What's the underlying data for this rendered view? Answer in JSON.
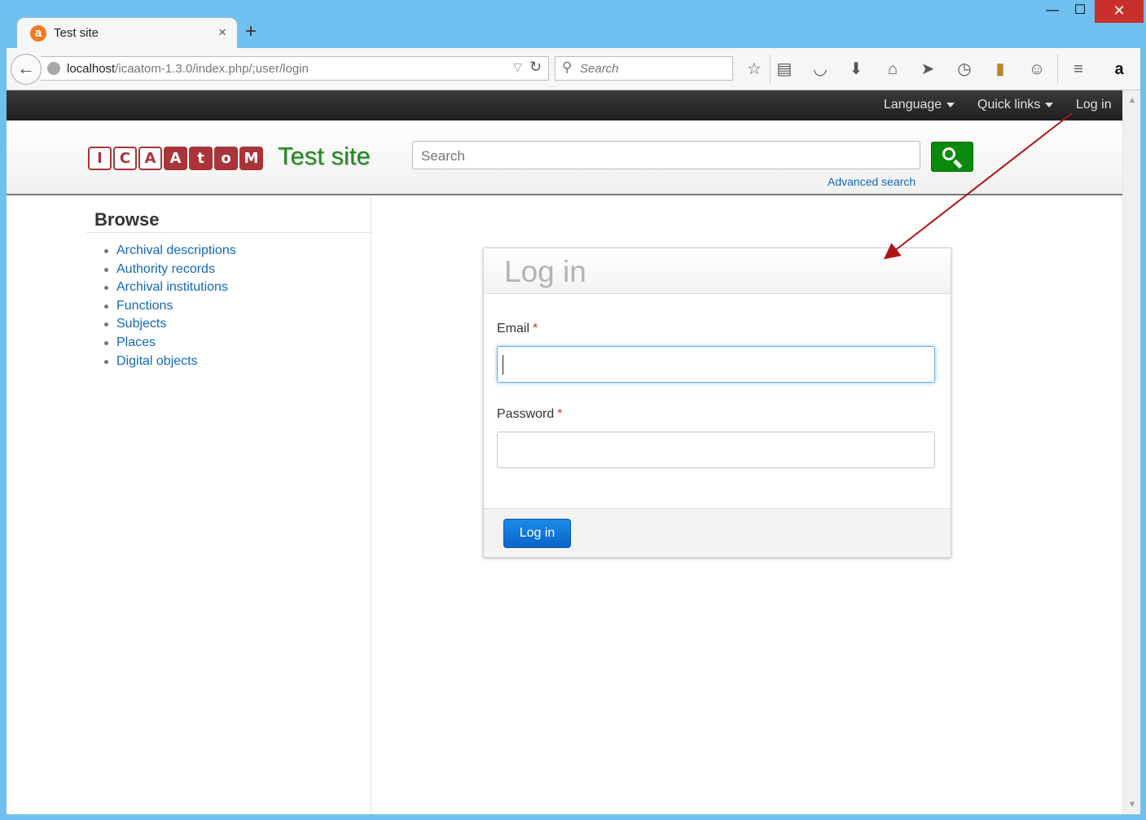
{
  "browser": {
    "tab_title": "Test site",
    "tab_favicon": "a",
    "tab_close": "×",
    "new_tab": "+",
    "window_minimize": "—",
    "window_maximize": "☐",
    "window_close": "✕",
    "url_host": "localhost",
    "url_path": "/icaatom-1.3.0/index.php/;user/login",
    "search_placeholder": "Search",
    "toolbar_icons": [
      "star-icon",
      "reading-list-icon",
      "pocket-icon",
      "download-icon",
      "home-icon",
      "send-icon",
      "history-icon",
      "bookmark-icon",
      "chat-icon",
      "menu-icon",
      "amazon-icon"
    ]
  },
  "site": {
    "topnav": {
      "language": "Language",
      "quick_links": "Quick links",
      "log_in": "Log in"
    },
    "logo_letters": [
      "I",
      "C",
      "A",
      "A",
      "t",
      "o",
      "M"
    ],
    "title": "Test site",
    "search_placeholder": "Search",
    "advanced_search": "Advanced search"
  },
  "sidebar": {
    "title": "Browse",
    "items": [
      {
        "label": "Archival descriptions"
      },
      {
        "label": "Authority records"
      },
      {
        "label": "Archival institutions"
      },
      {
        "label": "Functions"
      },
      {
        "label": "Subjects"
      },
      {
        "label": "Places"
      },
      {
        "label": "Digital objects"
      }
    ]
  },
  "login": {
    "title": "Log in",
    "email_label": "Email",
    "password_label": "Password",
    "required_marker": "*",
    "email_value": "",
    "password_value": "",
    "submit_label": "Log in"
  },
  "colors": {
    "frame": "#6fc0ef",
    "logo_red": "#a9343a",
    "site_title_green": "#1f8c1f",
    "link_blue": "#1468b8",
    "button_blue": "#0a64c8",
    "annotation_arrow": "#b01515"
  }
}
